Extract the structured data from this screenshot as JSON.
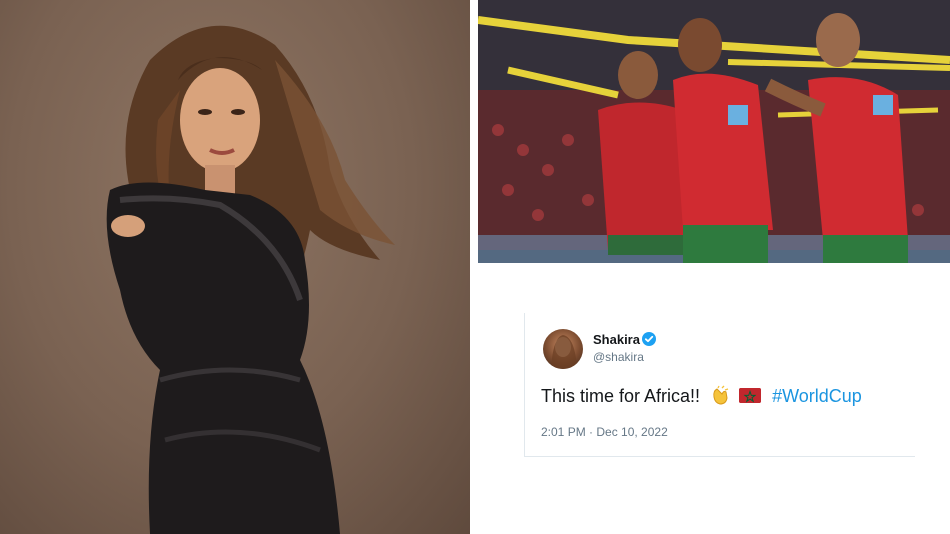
{
  "tweet": {
    "author_name": "Shakira",
    "author_handle": "@shakira",
    "text": "This time for Africa!!",
    "emoji_clap": "clapping-hands-icon",
    "emoji_flag": "morocco-flag-icon",
    "hashtag": "#WorldCup",
    "timestamp": "2:01 PM · Dec 10, 2022",
    "hashtag_color": "#1b95e0",
    "verified_color": "#1da1f2"
  },
  "photos": {
    "left": "shakira-portrait",
    "right": "morocco-players-celebrating"
  },
  "colors": {
    "morocco_red": "#c1272d",
    "morocco_green": "#006233"
  }
}
